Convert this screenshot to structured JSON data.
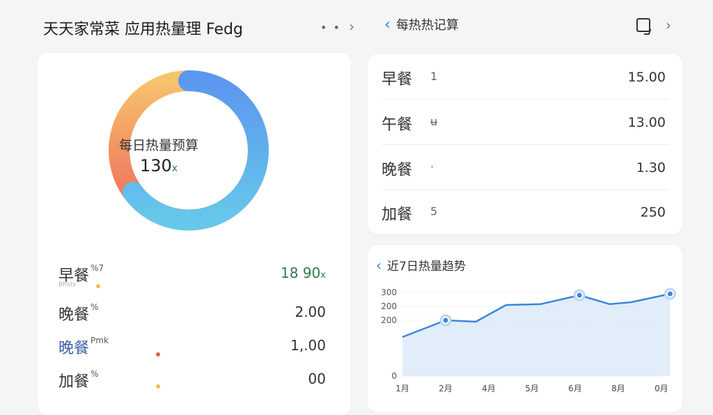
{
  "left_panel": {
    "title": "天天家常菜 应用热量理 Fedg",
    "more_label": "• •",
    "more_chevron": "›",
    "donut": {
      "label": "每日热量预算",
      "value": "130",
      "unit": "x"
    },
    "meals": [
      {
        "name": "早餐",
        "sup": "%7",
        "sub": "Bhsts",
        "value": "18 90",
        "unit": "x",
        "value_color": "#2f7a4f"
      },
      {
        "name": "晚餐",
        "sup": "%",
        "sub": "",
        "value": "2.00",
        "unit": "",
        "value_color": "#333333"
      },
      {
        "name": "晚餐",
        "sup": "Pmk",
        "sub": "",
        "value": "1,.00",
        "unit": "",
        "value_color": "#333333"
      },
      {
        "name": "加餐",
        "sup": "%",
        "sub": "",
        "value": "00",
        "unit": "",
        "value_color": "#333333"
      }
    ]
  },
  "right_panel": {
    "back_chevron": "‹",
    "title": "每热热记算",
    "next_chevron": "›",
    "items": [
      {
        "name": "早餐",
        "mark": "1",
        "value": "15.00"
      },
      {
        "name": "午餐",
        "mark": "ʉ",
        "value": "13.00"
      },
      {
        "name": "晚餐",
        "mark": "·",
        "value": "1.30"
      },
      {
        "name": "加餐",
        "mark": "5",
        "value": "250"
      }
    ]
  },
  "trend_panel": {
    "back_chevron": "‹",
    "title": "近7日热量趋势"
  },
  "chart_data": {
    "type": "area",
    "title": "近7日热量趋势",
    "xlabel": "",
    "ylabel": "",
    "categories": [
      "1月",
      "2月",
      "4月",
      "5月",
      "6月",
      "8月",
      "0月"
    ],
    "ytick_labels": [
      "300",
      "200",
      "200",
      "0"
    ],
    "ytick_values": [
      300,
      250,
      200,
      0
    ],
    "ylim": [
      0,
      300
    ],
    "x": [
      0,
      1,
      1.7,
      2.4,
      3.2,
      4.1,
      4.8,
      5.3,
      6.2
    ],
    "values": [
      140,
      200,
      195,
      255,
      258,
      290,
      258,
      265,
      295
    ],
    "highlighted_points": [
      1,
      5,
      8
    ],
    "grid": true,
    "colors": {
      "line": "#3b86dc",
      "fill": "#d6e6f8",
      "point_ring": "#bcd4f0"
    }
  },
  "colors": {
    "accent": "#2e7cf0",
    "donut_blue": "#5aa0ef",
    "donut_cyan": "#63c2ea",
    "donut_orange": "#f4b063",
    "donut_red": "#f07a60",
    "green": "#2f7a4f"
  }
}
